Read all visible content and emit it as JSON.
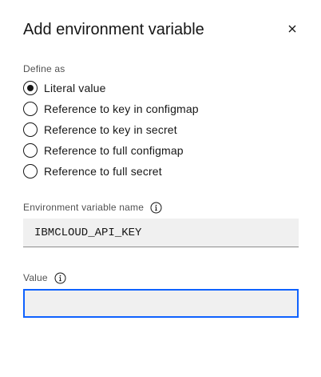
{
  "modal": {
    "title": "Add environment variable",
    "close_icon": "close-icon"
  },
  "define_as": {
    "legend": "Define as",
    "selected": "Literal value",
    "options": [
      {
        "label": "Literal value",
        "checked": true
      },
      {
        "label": "Reference to key in configmap",
        "checked": false
      },
      {
        "label": "Reference to key in secret",
        "checked": false
      },
      {
        "label": "Reference to full configmap",
        "checked": false
      },
      {
        "label": "Reference to full secret",
        "checked": false
      }
    ]
  },
  "env_name": {
    "label": "Environment variable name",
    "info_icon": "info-icon",
    "value": "IBMCLOUD_API_KEY"
  },
  "env_value": {
    "label": "Value",
    "info_icon": "info-icon",
    "value": ""
  },
  "colors": {
    "focus": "#0f62fe",
    "field_bg": "#f0f0f0",
    "text": "#161616",
    "label": "#525252"
  }
}
